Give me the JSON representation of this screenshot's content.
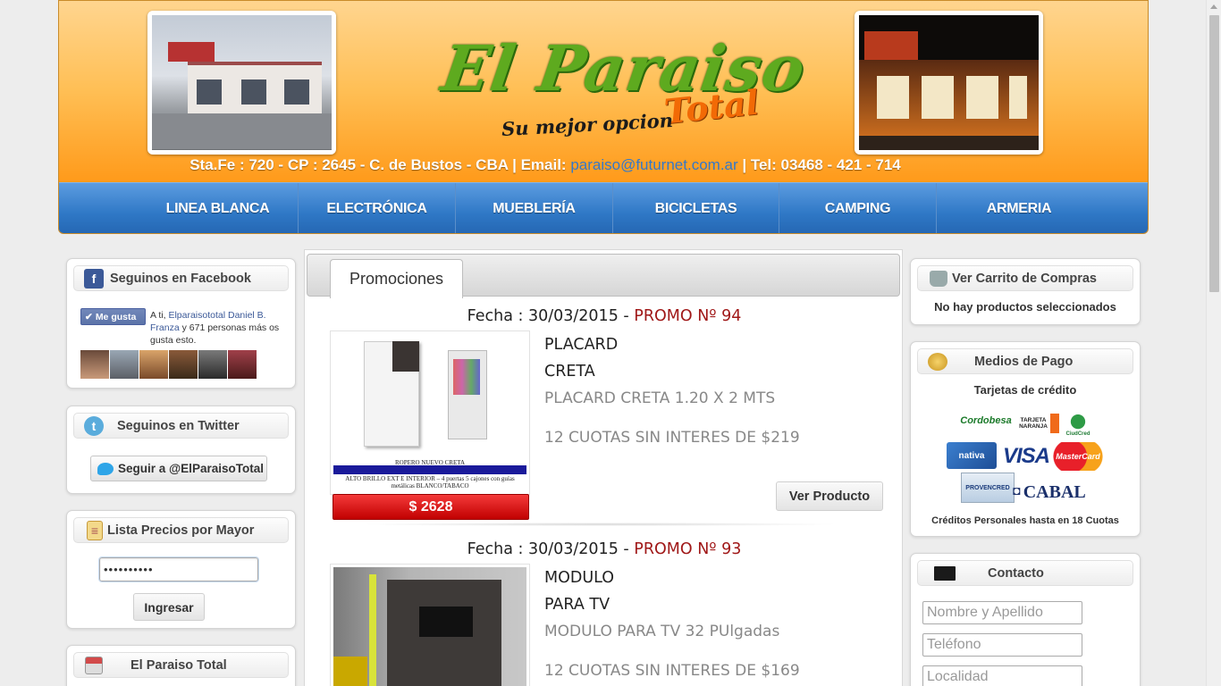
{
  "header": {
    "logo_main": "El Paraiso",
    "logo_sub": "Total",
    "logo_tagline": "Su mejor opcion",
    "address": "Sta.Fe : 720 - CP : 2645 - C. de Bustos - CBA | Email: ",
    "email": "paraiso@futurnet.com.ar",
    "phone": " | Tel: 03468 - 421 - 714"
  },
  "nav": [
    "LINEA BLANCA",
    "ELECTRÓNICA",
    "MUEBLERÍA",
    "BICICLETAS",
    "CAMPING",
    "ARMERIA"
  ],
  "facebook": {
    "title": "Seguinos en Facebook",
    "like_label": "Me gusta",
    "text_a": "A ti, ",
    "link_page": "Elparaisototal",
    "link_person": "Daniel B. Franza",
    "text_b": " y 671 personas más os gusta esto."
  },
  "twitter": {
    "title": "Seguinos en Twitter",
    "follow_label": "Seguir a @ElParaisoTotal"
  },
  "wholesale": {
    "title": "Lista Precios por Mayor",
    "password_value": "••••••••••",
    "login_label": "Ingresar"
  },
  "store_box": {
    "title": "El Paraiso Total"
  },
  "main": {
    "tab_label": "Promociones",
    "promos": [
      {
        "date_label": "Fecha : 30/03/2015 - ",
        "promo_label": "PROMO Nº 94",
        "title_line1": "PLACARD",
        "title_line2": "CRETA",
        "subtitle": "PLACARD CRETA 1.20 X 2 MTS",
        "installments": "12 CUOTAS SIN INTERES DE $219",
        "price": "$ 2628",
        "view_label": "Ver Producto",
        "img_caption": "ROPERO NUEVO CRETA",
        "img_caption2": "ALTO BRILLO EXT E INTERIOR – 4 puertas 5 cajones con guías metálicas BLANCO/TABACO"
      },
      {
        "date_label": "Fecha : 30/03/2015 - ",
        "promo_label": "PROMO Nº 93",
        "title_line1": "MODULO",
        "title_line2": "PARA TV",
        "subtitle": "MODULO PARA TV 32 PUlgadas",
        "installments": "12 CUOTAS SIN INTERES DE $169"
      }
    ]
  },
  "cart": {
    "title": "Ver Carrito de Compras",
    "empty_text": "No hay productos seleccionados"
  },
  "payment": {
    "title": "Medios de Pago",
    "subtitle": "Tarjetas de crédito",
    "cards": [
      "Cordobesa",
      "TARJETA NARANJA",
      "CiudCred",
      "nativa",
      "VISA",
      "MasterCard",
      "PROVENCRED",
      "CABAL"
    ],
    "footer": "Créditos Personales hasta en 18 Cuotas"
  },
  "contact": {
    "title": "Contacto",
    "name_placeholder": "Nombre y Apellido",
    "phone_placeholder": "Teléfono",
    "city_placeholder": "Localidad"
  }
}
